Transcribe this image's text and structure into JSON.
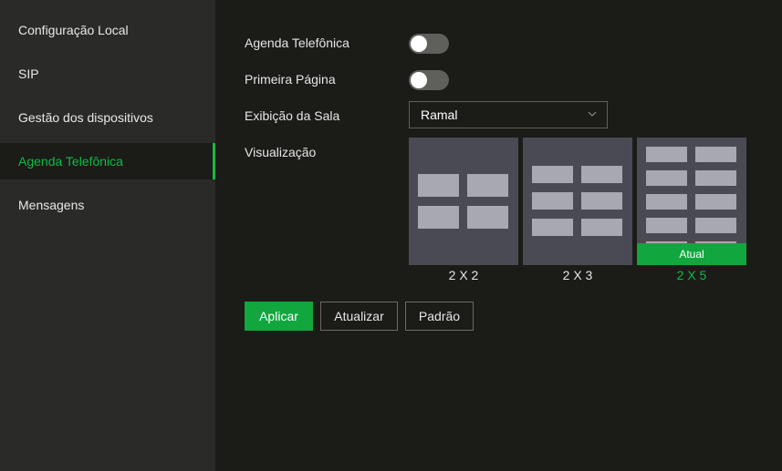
{
  "sidebar": {
    "items": [
      {
        "label": "Configuração Local"
      },
      {
        "label": "SIP"
      },
      {
        "label": "Gestão dos dispositivos"
      },
      {
        "label": "Agenda Telefônica"
      },
      {
        "label": "Mensagens"
      }
    ],
    "active_item": "Agenda Telefônica"
  },
  "form": {
    "phonebook_label": "Agenda Telefônica",
    "phonebook_enabled": false,
    "first_page_label": "Primeira Página",
    "first_page_enabled": false,
    "room_display_label": "Exibição da Sala",
    "room_display_value": "Ramal",
    "view_label": "Visualização"
  },
  "layouts": {
    "options": [
      {
        "caption": "2 X 2",
        "cols": 2,
        "rows": 2
      },
      {
        "caption": "2 X 3",
        "cols": 2,
        "rows": 3
      },
      {
        "caption": "2 X 5",
        "cols": 2,
        "rows": 5
      }
    ],
    "current_badge": "Atual",
    "selected": "2 X 5"
  },
  "buttons": {
    "apply": "Aplicar",
    "refresh": "Atualizar",
    "default": "Padrão"
  },
  "colors": {
    "accent": "#14b845",
    "sidebar_bg": "#2a2b29",
    "main_bg": "#1b1c18",
    "toggle_off": "#5f605c",
    "card_bg": "#4a4a54",
    "cell": "#a8a8b2"
  }
}
